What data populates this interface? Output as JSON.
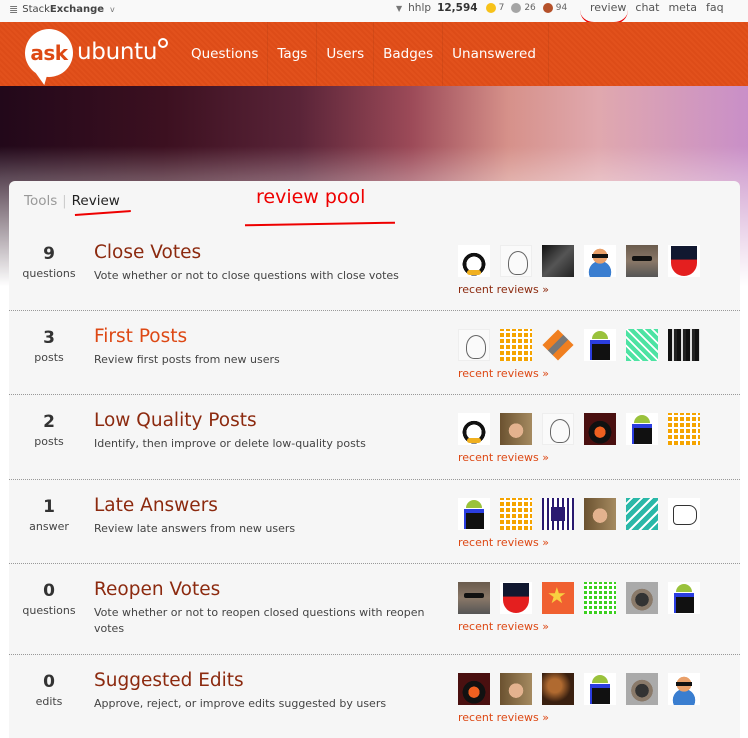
{
  "topbar": {
    "brand_prefix": "Stack",
    "brand_bold": "Exchange",
    "user": {
      "name": "hhlp",
      "reputation": "12,594",
      "badges": {
        "gold": "7",
        "silver": "26",
        "bronze": "94"
      }
    },
    "links": [
      "review",
      "chat",
      "meta",
      "faq"
    ]
  },
  "header": {
    "logo_ask": "ask",
    "logo_ubuntu": "ubuntu",
    "nav": [
      "Questions",
      "Tags",
      "Users",
      "Badges",
      "Unanswered"
    ],
    "accent_color": "#dd4814"
  },
  "tabs": {
    "tools": "Tools",
    "separator": "|",
    "review": "Review"
  },
  "annotation": {
    "label": "review pool",
    "color": "#ee0000"
  },
  "queues": [
    {
      "count": "9",
      "unit": "questions",
      "title": "Close Votes",
      "description": "Vote whether or not to close questions with close votes",
      "visited": false,
      "avatars": [
        "penguin",
        "sketch-face",
        "dark-photo",
        "cartoon-sunglasses",
        "sunglasses-photo",
        "red-shield"
      ],
      "recent_link": "recent reviews »"
    },
    {
      "count": "3",
      "unit": "posts",
      "title": "First Posts",
      "description": "Review first posts from new users",
      "visited": true,
      "avatars": [
        "sketch-face",
        "orange-identicon",
        "orange-diamond",
        "android",
        "teal-identicon",
        "bw-photo"
      ],
      "recent_link": "recent reviews »"
    },
    {
      "count": "2",
      "unit": "posts",
      "title": "Low Quality Posts",
      "description": "Identify, then improve or delete low-quality posts",
      "visited": false,
      "avatars": [
        "penguin",
        "boy-photo",
        "sketch-face",
        "bird-photo",
        "android",
        "orange-identicon"
      ],
      "recent_link": "recent reviews »"
    },
    {
      "count": "1",
      "unit": "answer",
      "title": "Late Answers",
      "description": "Review late answers from new users",
      "visited": false,
      "avatars": [
        "android",
        "orange-identicon",
        "navy-identicon",
        "boy-photo",
        "teal-identicon-2",
        "fist"
      ],
      "recent_link": "recent reviews »"
    },
    {
      "count": "0",
      "unit": "questions",
      "title": "Reopen Votes",
      "description": "Vote whether or not to reopen closed questions with reopen votes",
      "visited": false,
      "avatars": [
        "sunglasses-photo",
        "red-shield",
        "star-avatar",
        "green-identicon",
        "well-photo",
        "android"
      ],
      "recent_link": "recent reviews »"
    },
    {
      "count": "0",
      "unit": "edits",
      "title": "Suggested Edits",
      "description": "Approve, reject, or improve edits suggested by users",
      "visited": false,
      "avatars": [
        "bird-photo",
        "boy-photo",
        "mushroom-photo",
        "android",
        "well-photo",
        "cartoon-sunglasses"
      ],
      "recent_link": "recent reviews »"
    }
  ]
}
